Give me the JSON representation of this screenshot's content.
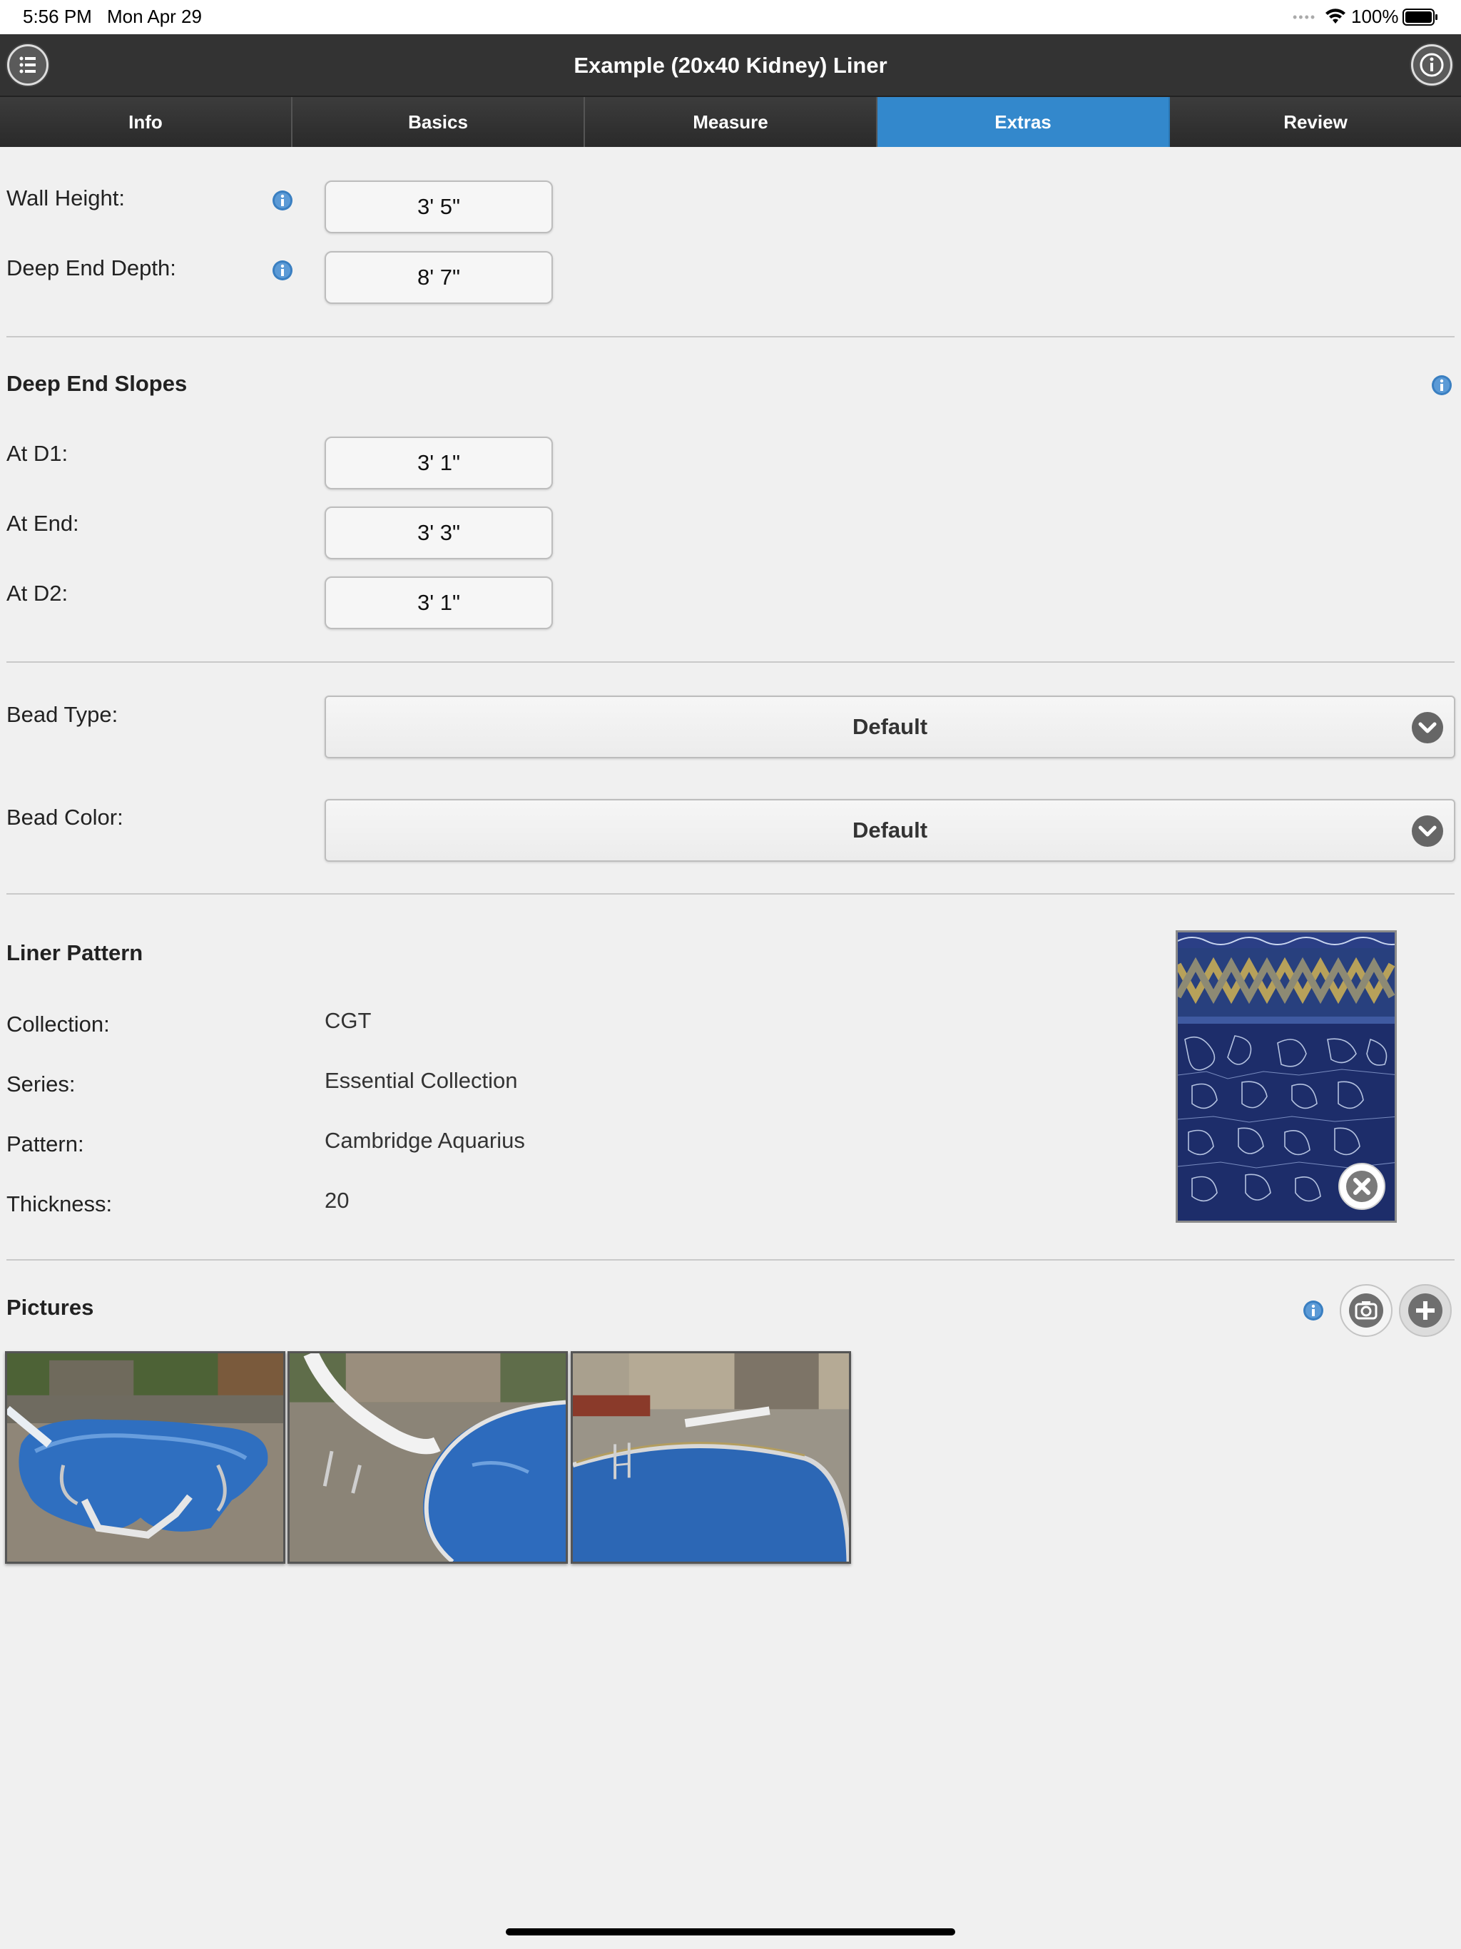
{
  "status_bar": {
    "time": "5:56 PM",
    "date": "Mon Apr 29",
    "battery": "100%"
  },
  "header": {
    "title": "Example (20x40 Kidney) Liner"
  },
  "tabs": [
    {
      "label": "Info"
    },
    {
      "label": "Basics"
    },
    {
      "label": "Measure"
    },
    {
      "label": "Extras",
      "active": true
    },
    {
      "label": "Review"
    }
  ],
  "dimensions": {
    "wall_height": {
      "label": "Wall Height:",
      "value": "3' 5\""
    },
    "deep_end_depth": {
      "label": "Deep End Depth:",
      "value": "8' 7\""
    }
  },
  "slopes": {
    "title": "Deep End Slopes",
    "at_d1": {
      "label": "At D1:",
      "value": "3' 1\""
    },
    "at_end": {
      "label": "At End:",
      "value": "3' 3\""
    },
    "at_d2": {
      "label": "At D2:",
      "value": "3' 1\""
    }
  },
  "bead": {
    "type": {
      "label": "Bead Type:",
      "value": "Default"
    },
    "color": {
      "label": "Bead Color:",
      "value": "Default"
    }
  },
  "liner_pattern": {
    "title": "Liner Pattern",
    "collection": {
      "label": "Collection:",
      "value": "CGT"
    },
    "series": {
      "label": "Series:",
      "value": "Essential Collection"
    },
    "pattern": {
      "label": "Pattern:",
      "value": "Cambridge Aquarius"
    },
    "thickness": {
      "label": "Thickness:",
      "value": "20"
    }
  },
  "pictures": {
    "title": "Pictures",
    "count": 3
  },
  "icons": {
    "menu": "list-icon",
    "about": "info-circle-icon",
    "info": "info-icon",
    "dropdown": "chevron-down-icon",
    "remove": "close-circle-icon",
    "camera": "camera-icon",
    "add": "plus-icon"
  },
  "colors": {
    "header": "#333333",
    "active_tab": "#3388cc",
    "info_blue": "#3a7fc1"
  }
}
